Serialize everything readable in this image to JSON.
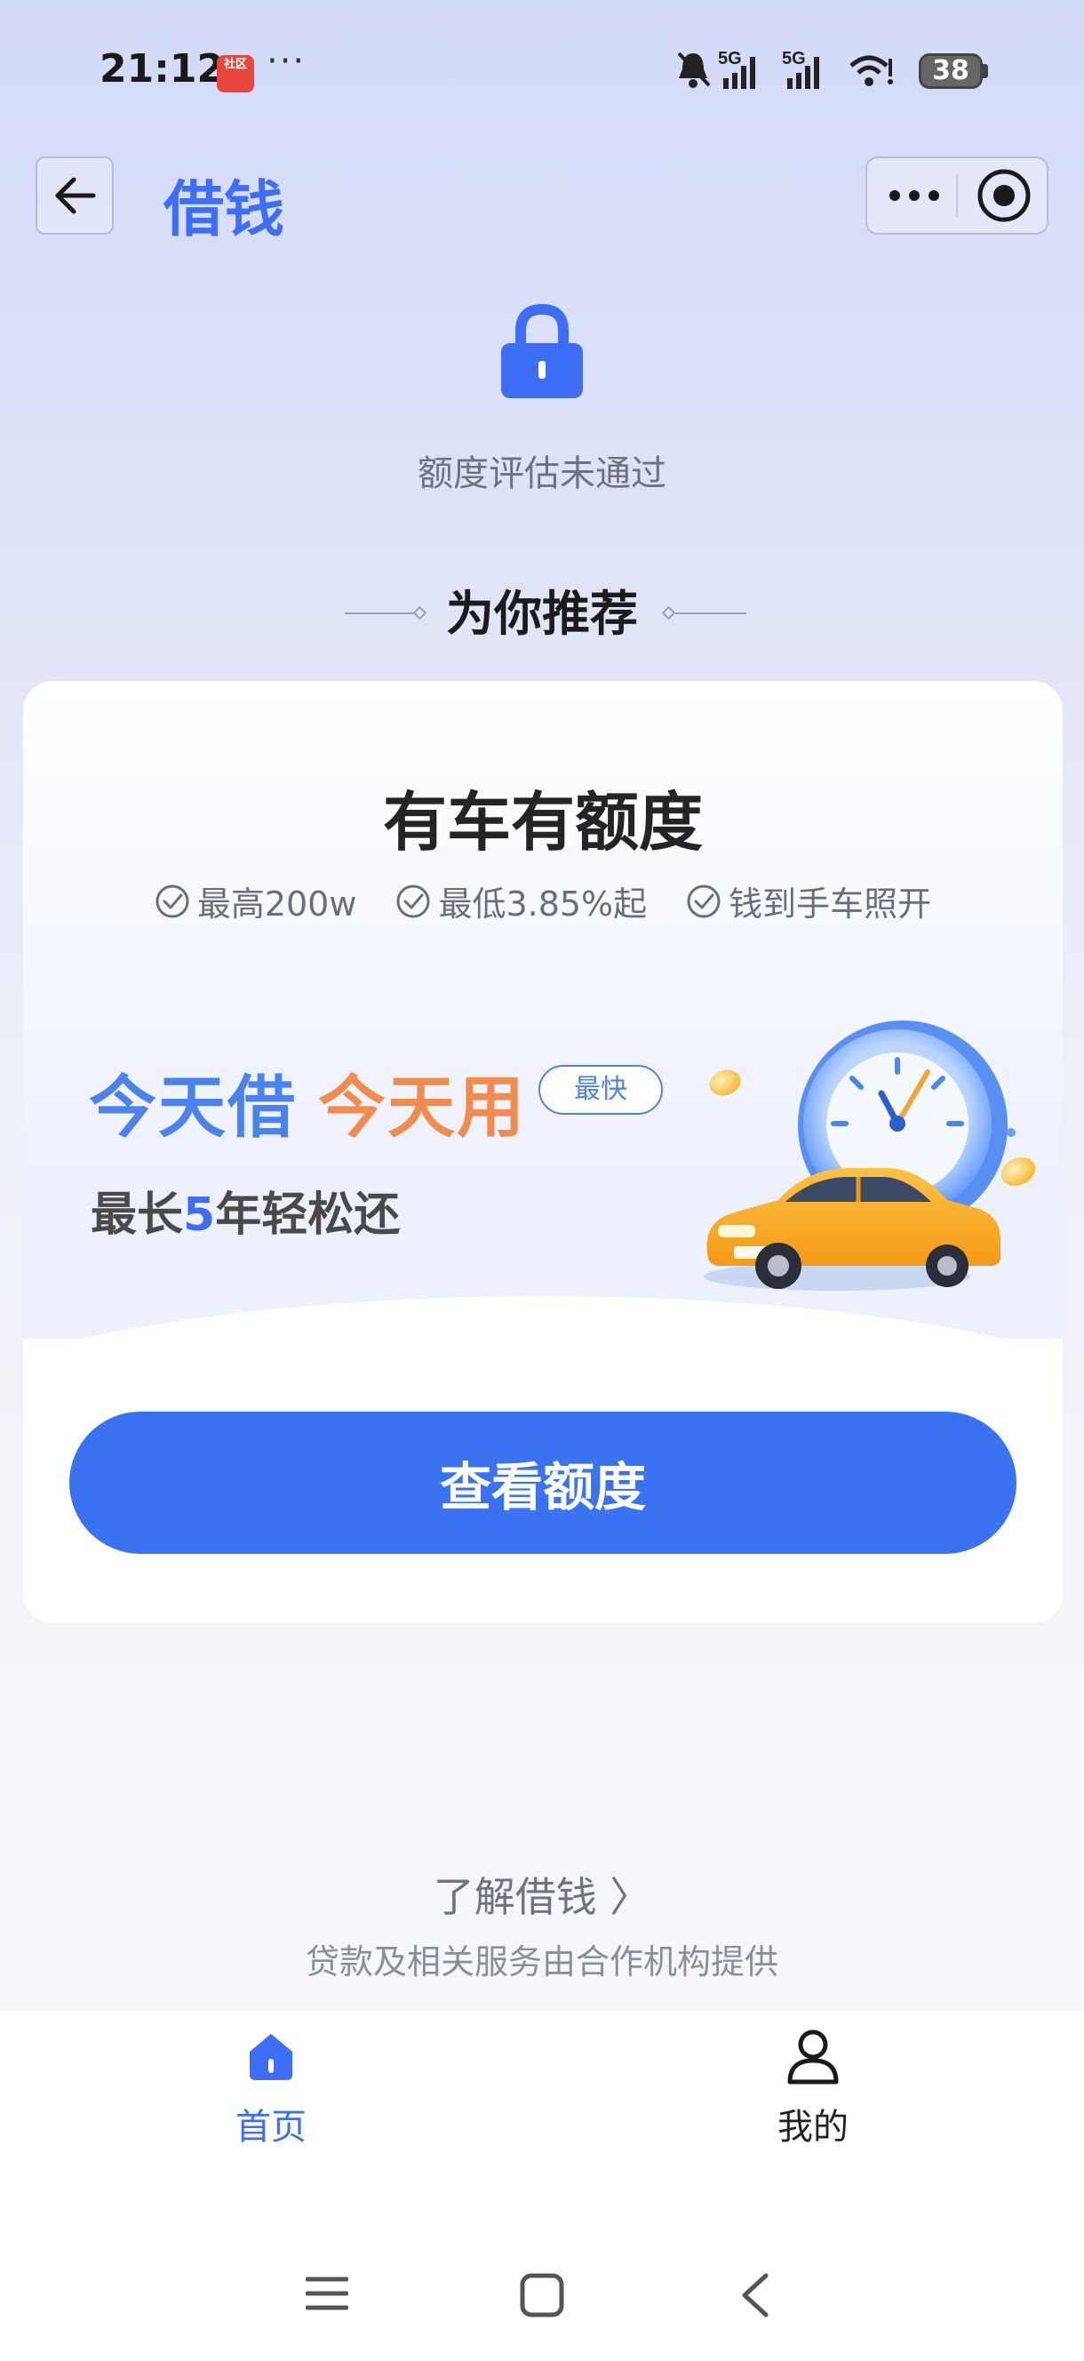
{
  "status_bar": {
    "time": "21:12",
    "app_badge": "社区",
    "dots": "···",
    "network_1": "5G",
    "network_2": "5G",
    "battery": "38"
  },
  "header": {
    "title": "借钱",
    "back_icon": "arrow-left-icon",
    "more_icon": "more-dots-icon",
    "close_icon": "target-close-icon"
  },
  "assessment": {
    "icon": "lock-icon",
    "status": "额度评估未通过"
  },
  "recommend": {
    "title": "为你推荐"
  },
  "card": {
    "title": "有车有额度",
    "features": [
      "最高200w",
      "最低3.85%起",
      "钱到手车照开"
    ],
    "slogan_a": "今天借",
    "slogan_b": "今天用",
    "badge": "最快",
    "repay_prefix": "最长",
    "repay_num": "5",
    "repay_suffix": "年轻松还",
    "cta": "查看额度"
  },
  "footer": {
    "learn_more": "了解借钱 〉",
    "provider_note": "贷款及相关服务由合作机构提供"
  },
  "tabs": [
    {
      "label": "首页",
      "icon": "home-icon",
      "active": true
    },
    {
      "label": "我的",
      "icon": "user-icon",
      "active": false
    }
  ],
  "colors": {
    "accent": "#3a73f2",
    "slogan_blue": "#4b82ee",
    "slogan_orange": "#f08c50"
  }
}
